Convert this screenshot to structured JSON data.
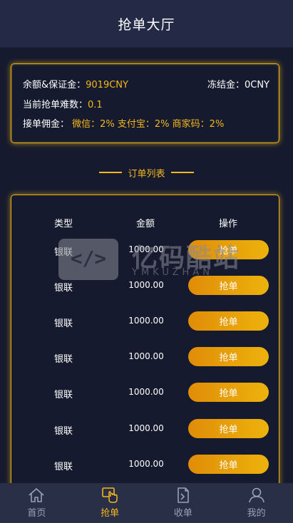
{
  "header": {
    "title": "抢单大厅"
  },
  "account": {
    "balance_label": "余额&保证金：",
    "balance_value": "9019CNY",
    "frozen_label": "冻结金：",
    "frozen_value": "0CNY",
    "difficulty_label": "当前抢单难数：",
    "difficulty_value": "0.1",
    "commission_label": "接单佣金：",
    "commission_value": "微信：2% 支付宝：2% 商家码：2%"
  },
  "section": {
    "title": "订单列表"
  },
  "table": {
    "headers": [
      "类型",
      "金额",
      "操作"
    ],
    "rows": [
      {
        "type": "银联",
        "amount": "1000.00",
        "action": "抢单"
      },
      {
        "type": "银联",
        "amount": "1000.00",
        "action": "抢单"
      },
      {
        "type": "银联",
        "amount": "1000.00",
        "action": "抢单"
      },
      {
        "type": "银联",
        "amount": "1000.00",
        "action": "抢单"
      },
      {
        "type": "银联",
        "amount": "1000.00",
        "action": "抢单"
      },
      {
        "type": "银联",
        "amount": "1000.00",
        "action": "抢单"
      },
      {
        "type": "银联",
        "amount": "1000.00",
        "action": "抢单"
      }
    ]
  },
  "watermark": {
    "mark": "</>",
    "text": "亿码酷站",
    "sub": "YMKUZHAN"
  },
  "tabbar": {
    "items": [
      {
        "label": "首页",
        "icon": "home-icon",
        "active": false
      },
      {
        "label": "抢单",
        "icon": "grab-hand-icon",
        "active": true
      },
      {
        "label": "收单",
        "icon": "receipt-icon",
        "active": false
      },
      {
        "label": "我的",
        "icon": "user-icon",
        "active": false
      }
    ]
  },
  "colors": {
    "accent": "#f4b81c",
    "background": "#161a2e",
    "header": "#242a45",
    "tabbar": "#2a2f48",
    "button_from": "#e08d08",
    "button_to": "#edb20c"
  }
}
